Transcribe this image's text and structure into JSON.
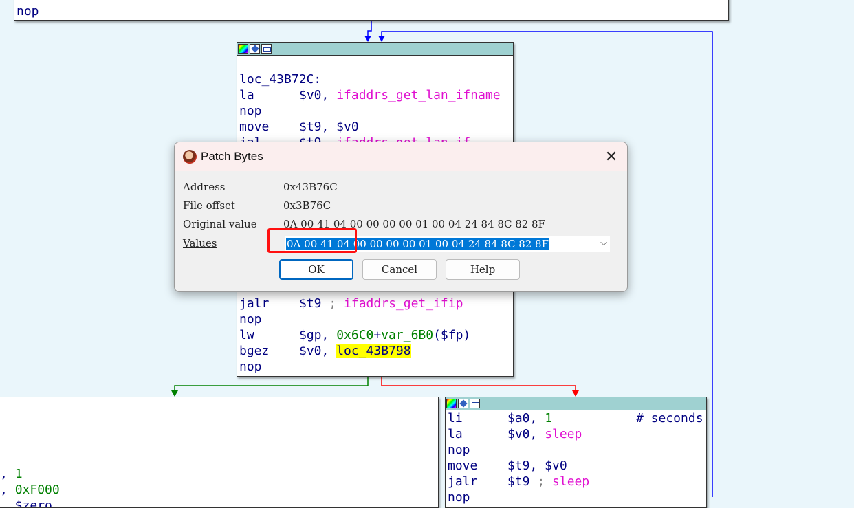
{
  "top_node": {
    "lines": [
      {
        "mn": "nop",
        "rest": ""
      }
    ]
  },
  "main_node": {
    "label": "loc_43B72C:",
    "lines_top": [
      {
        "mn": "la",
        "a": "$v0, ",
        "b": "ifaddrs_get_lan_ifname"
      },
      {
        "mn": "nop",
        "a": "",
        "b": ""
      },
      {
        "mn": "move",
        "a": "$t9, $v0",
        "b": ""
      },
      {
        "mn": "jal",
        "a": "$t9, ",
        "b": "ifaddrs_get_lan_if"
      }
    ],
    "lines_bottom": [
      {
        "mn": "jalr",
        "a": "$t9 ",
        "c": "; ",
        "b": "ifaddrs_get_ifip"
      },
      {
        "mn": "nop",
        "a": "",
        "c": "",
        "b": ""
      },
      {
        "mn": "lw",
        "a": "$gp, ",
        "num": "0x6C0",
        "plus": "+",
        "b2": "var_6B0",
        "tail": "($fp)"
      },
      {
        "mn": "bgez",
        "a": "$v0, ",
        "hl": "loc_43B798"
      },
      {
        "mn": "nop",
        "a": "",
        "b": ""
      }
    ]
  },
  "right_node": {
    "lines": [
      {
        "mn": "li",
        "a": "$a0, ",
        "num": "1",
        "cmt": "# seconds"
      },
      {
        "mn": "la",
        "a": "$v0, ",
        "b": "sleep"
      },
      {
        "mn": "nop",
        "a": "",
        "b": ""
      },
      {
        "mn": "move",
        "a": "$t9, $v0",
        "b": ""
      },
      {
        "mn": "jalr",
        "a": "$t9 ",
        "c": "; ",
        "b": "sleep"
      },
      {
        "mn": "nop",
        "a": "",
        "b": ""
      }
    ]
  },
  "left_node": {
    "lines": [
      {
        "a": ", ",
        "num": "1"
      },
      {
        "a": ", ",
        "num": "0xF000"
      },
      {
        "a": ", $zero",
        "num": ""
      }
    ]
  },
  "dialog": {
    "title": "Patch Bytes",
    "close": "✕",
    "address_label": "Address",
    "address_value": "0x43B76C",
    "offset_label": "File offset",
    "offset_value": "0x3B76C",
    "original_label": "Original value",
    "original_value": "0A 00 41 04 00 00 00 00 01 00 04 24 84 8C 82 8F",
    "values_label": "Values",
    "values_value": "0A 00 41 04 00 00 00 00 01 00 04 24 84 8C 82 8F",
    "chevron": "⌵",
    "ok_label": "OK",
    "cancel_label": "Cancel",
    "help_label": "Help"
  },
  "colors": {
    "background": "#eaf6fb",
    "node_titlebar": "#9fd1d1",
    "function_name": "#e010d0",
    "number": "#008000",
    "highlight": "#ffff00",
    "edge_true": "#008000",
    "edge_false": "#ff0000",
    "edge_back": "#0000ff",
    "annotation": "#ff1010"
  },
  "icons": [
    "color-palette-icon",
    "rename-icon",
    "graph-icon",
    "app-icon",
    "close-icon",
    "chevron-down-icon"
  ]
}
